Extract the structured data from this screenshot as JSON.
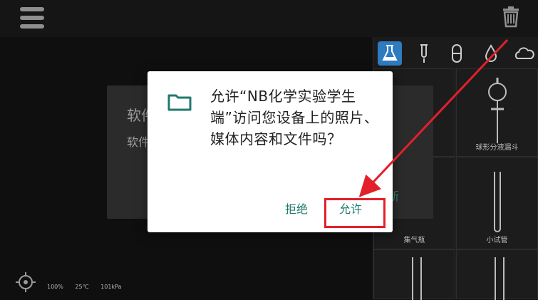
{
  "topbar": {
    "menu_icon": "hamburger-menu-icon",
    "trash_icon": "trash-icon"
  },
  "tool_tabs": [
    "beaker-icon",
    "test-tube-icon",
    "capsule-icon",
    "droplet-icon",
    "cloud-icon"
  ],
  "grid": {
    "items": [
      {
        "label": ""
      },
      {
        "label": "球形分液漏斗"
      },
      {
        "label": "集气瓶"
      },
      {
        "label": "小试管"
      },
      {
        "label": ""
      },
      {
        "label": ""
      }
    ]
  },
  "background_dialog": {
    "title_fragment": "软件",
    "body_fragment": "软件",
    "action_fragment": "更新"
  },
  "status_bar": {
    "zoom": "100%",
    "temperature": "25℃",
    "pressure": "101kPa"
  },
  "permission_dialog": {
    "message": "允许“NB化学实验学生端”访问您设备上的照片、媒体内容和文件吗？",
    "deny_label": "拒绝",
    "allow_label": "允许"
  },
  "colors": {
    "accent": "#1f7a6e",
    "annotation": "#e3202a",
    "tab_active": "#2f7bbf"
  }
}
